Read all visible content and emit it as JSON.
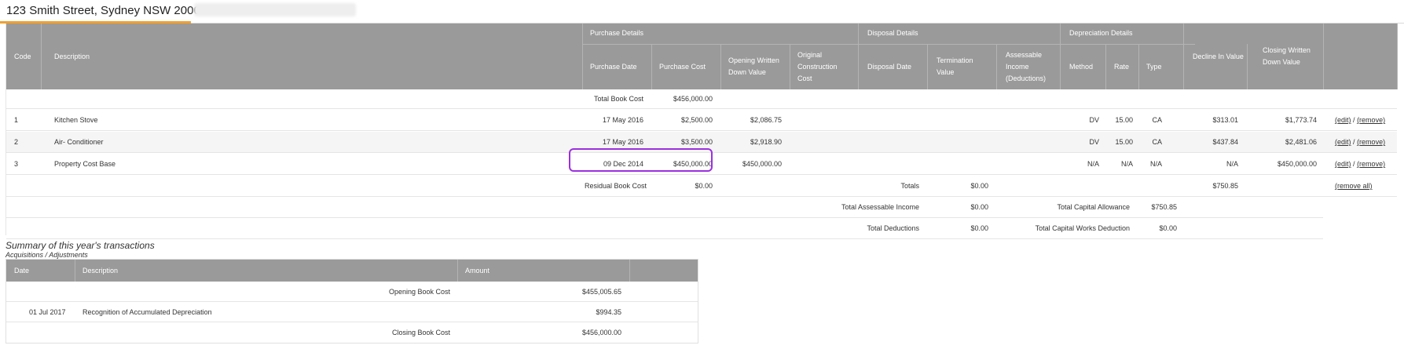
{
  "tab": {
    "title": "123 Smith Street, Sydney NSW 2000"
  },
  "table": {
    "groups": {
      "purchase": "Purchase Details",
      "disposal": "Disposal Details",
      "depreciation": "Depreciation Details"
    },
    "headers": {
      "code": "Code",
      "description": "Description",
      "purchase_date": "Purchase Date",
      "purchase_cost": "Purchase Cost",
      "opening_wdv": "Opening Written Down Value",
      "original_construction_cost": "Original Construction Cost",
      "disposal_date": "Disposal Date",
      "termination_value": "Termination Value",
      "assessable_income": "Assessable Income (Deductions)",
      "method": "Method",
      "rate": "Rate",
      "type": "Type",
      "decline_in_value": "Decline In Value",
      "closing_wdv": "Closing Written Down Value"
    },
    "total_book_cost": {
      "label": "Total Book Cost",
      "value": "$456,000.00"
    },
    "rows": [
      {
        "code": "1",
        "description": "Kitchen Stove",
        "purchase_date": "17 May 2016",
        "purchase_cost": "$2,500.00",
        "opening_wdv": "$2,086.75",
        "method": "DV",
        "rate": "15.00",
        "type": "CA",
        "decline": "$313.01",
        "closing": "$1,773.74",
        "edit": "(edit)",
        "sep": "/",
        "remove": "(remove)"
      },
      {
        "code": "2",
        "description": "Air- Conditioner",
        "purchase_date": "17 May 2016",
        "purchase_cost": "$3,500.00",
        "opening_wdv": "$2,918.90",
        "method": "DV",
        "rate": "15.00",
        "type": "CA",
        "decline": "$437.84",
        "closing": "$2,481.06",
        "edit": "(edit)",
        "sep": "/",
        "remove": "(remove)"
      },
      {
        "code": "3",
        "description": "Property Cost Base",
        "purchase_date": "09 Dec 2014",
        "purchase_cost": "$450,000.00",
        "opening_wdv": "$450,000.00",
        "method": "N/A",
        "rate": "N/A",
        "type": "N/A",
        "decline": "N/A",
        "closing": "$450,000.00",
        "edit": "(edit)",
        "sep": "/",
        "remove": "(remove)"
      }
    ],
    "residual": {
      "label": "Residual Book Cost",
      "value": "$0.00"
    },
    "totals": {
      "label": "Totals",
      "value": "$0.00",
      "decline": "$750.85",
      "remove_all": "(remove all)"
    },
    "assessable": {
      "label": "Total Assessable Income",
      "value": "$0.00",
      "cap_label": "Total Capital Allowance",
      "cap_value": "$750.85"
    },
    "deductions": {
      "label": "Total Deductions",
      "value": "$0.00",
      "cw_label": "Total Capital Works Deduction",
      "cw_value": "$0.00"
    }
  },
  "summary": {
    "title": "Summary of this year's transactions",
    "subtitle": "Acquisitions / Adjustments",
    "headers": {
      "date": "Date",
      "description": "Description",
      "amount": "Amount"
    },
    "opening": {
      "label": "Opening Book Cost",
      "value": "$455,005.65"
    },
    "rows": [
      {
        "date": "01 Jul 2017",
        "description": "Recognition of Accumulated Depreciation",
        "amount": "$994.35"
      }
    ],
    "closing": {
      "label": "Closing Book Cost",
      "value": "$456,000.00"
    }
  },
  "colors": {
    "header_bg": "#9a9a9a",
    "tab_accent": "#f0a030",
    "highlight": "#9b30e0"
  }
}
